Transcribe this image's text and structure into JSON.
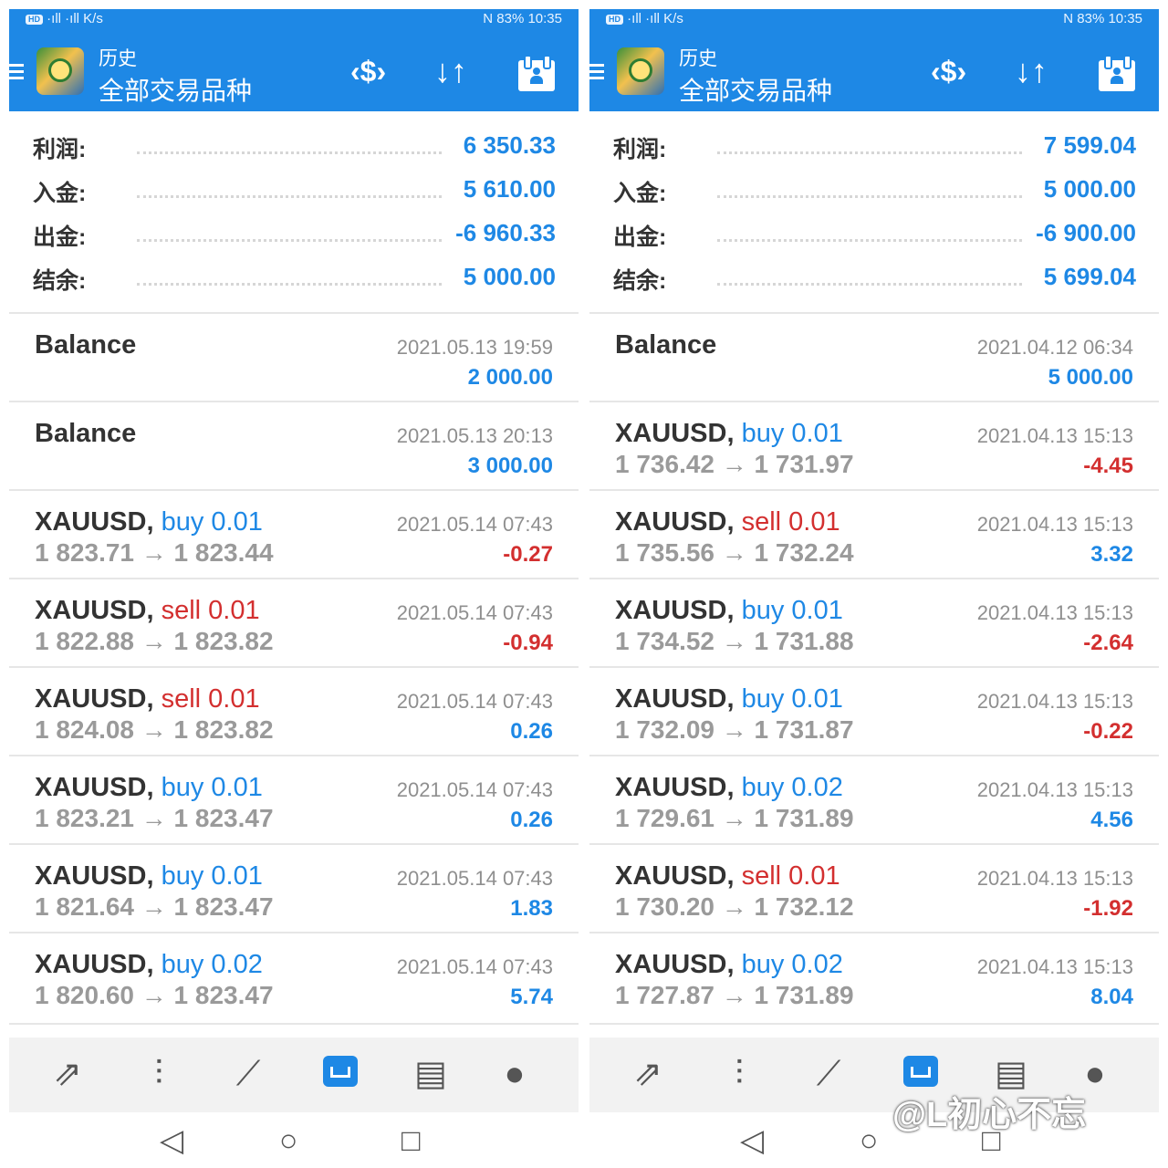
{
  "status_bar": {
    "signal": "·ıll ·ıll",
    "rate": "K/s",
    "right": "N 83% 10:35",
    "hd": "HD"
  },
  "appbar": {
    "title_small": "历史",
    "title_big": "全部交易品种",
    "money_icon": "$",
    "sort_icon": "↓↑"
  },
  "icons": {
    "nav": [
      "trade-arrows-icon",
      "candlestick-icon",
      "chart-line-icon",
      "inbox-icon",
      "news-icon",
      "chat-icon"
    ],
    "system": [
      "back-icon",
      "home-icon",
      "recents-icon"
    ]
  },
  "colors": {
    "brand": "#1e88e5",
    "negative": "#d32f2f"
  },
  "panels": [
    {
      "summary": [
        {
          "label": "利润:",
          "value": "6 350.33"
        },
        {
          "label": "入金:",
          "value": "5 610.00"
        },
        {
          "label": "出金:",
          "value": "-6 960.33"
        },
        {
          "label": "结余:",
          "value": "5 000.00"
        }
      ],
      "items": [
        {
          "symbol": "Balance",
          "sep": "",
          "action": "",
          "side": "",
          "price": "",
          "date": "2021.05.13 19:59",
          "profit": "2 000.00",
          "sign": "pos"
        },
        {
          "symbol": "Balance",
          "sep": "",
          "action": "",
          "side": "",
          "price": "",
          "date": "2021.05.13 20:13",
          "profit": "3 000.00",
          "sign": "pos"
        },
        {
          "symbol": "XAUUSD",
          "sep": ", ",
          "action": "buy 0.01",
          "side": "buy",
          "price": "1 823.71 → 1 823.44",
          "date": "2021.05.14 07:43",
          "profit": "-0.27",
          "sign": "neg"
        },
        {
          "symbol": "XAUUSD",
          "sep": ", ",
          "action": "sell 0.01",
          "side": "sell",
          "price": "1 822.88 → 1 823.82",
          "date": "2021.05.14 07:43",
          "profit": "-0.94",
          "sign": "neg"
        },
        {
          "symbol": "XAUUSD",
          "sep": ", ",
          "action": "sell 0.01",
          "side": "sell",
          "price": "1 824.08 → 1 823.82",
          "date": "2021.05.14 07:43",
          "profit": "0.26",
          "sign": "pos"
        },
        {
          "symbol": "XAUUSD",
          "sep": ", ",
          "action": "buy 0.01",
          "side": "buy",
          "price": "1 823.21 → 1 823.47",
          "date": "2021.05.14 07:43",
          "profit": "0.26",
          "sign": "pos"
        },
        {
          "symbol": "XAUUSD",
          "sep": ", ",
          "action": "buy 0.01",
          "side": "buy",
          "price": "1 821.64 → 1 823.47",
          "date": "2021.05.14 07:43",
          "profit": "1.83",
          "sign": "pos"
        },
        {
          "symbol": "XAUUSD",
          "sep": ", ",
          "action": "buy 0.02",
          "side": "buy",
          "price": "1 820.60 → 1 823.47",
          "date": "2021.05.14 07:43",
          "profit": "5.74",
          "sign": "pos"
        }
      ]
    },
    {
      "summary": [
        {
          "label": "利润:",
          "value": "7 599.04"
        },
        {
          "label": "入金:",
          "value": "5 000.00"
        },
        {
          "label": "出金:",
          "value": "-6 900.00"
        },
        {
          "label": "结余:",
          "value": "5 699.04"
        }
      ],
      "items": [
        {
          "symbol": "Balance",
          "sep": "",
          "action": "",
          "side": "",
          "price": "",
          "date": "2021.04.12 06:34",
          "profit": "5 000.00",
          "sign": "pos"
        },
        {
          "symbol": "XAUUSD",
          "sep": ", ",
          "action": "buy 0.01",
          "side": "buy",
          "price": "1 736.42 → 1 731.97",
          "date": "2021.04.13 15:13",
          "profit": "-4.45",
          "sign": "neg"
        },
        {
          "symbol": "XAUUSD",
          "sep": ", ",
          "action": "sell 0.01",
          "side": "sell",
          "price": "1 735.56 → 1 732.24",
          "date": "2021.04.13 15:13",
          "profit": "3.32",
          "sign": "pos"
        },
        {
          "symbol": "XAUUSD",
          "sep": ", ",
          "action": "buy 0.01",
          "side": "buy",
          "price": "1 734.52 → 1 731.88",
          "date": "2021.04.13 15:13",
          "profit": "-2.64",
          "sign": "neg"
        },
        {
          "symbol": "XAUUSD",
          "sep": ", ",
          "action": "buy 0.01",
          "side": "buy",
          "price": "1 732.09 → 1 731.87",
          "date": "2021.04.13 15:13",
          "profit": "-0.22",
          "sign": "neg"
        },
        {
          "symbol": "XAUUSD",
          "sep": ", ",
          "action": "buy 0.02",
          "side": "buy",
          "price": "1 729.61 → 1 731.89",
          "date": "2021.04.13 15:13",
          "profit": "4.56",
          "sign": "pos"
        },
        {
          "symbol": "XAUUSD",
          "sep": ", ",
          "action": "sell 0.01",
          "side": "sell",
          "price": "1 730.20 → 1 732.12",
          "date": "2021.04.13 15:13",
          "profit": "-1.92",
          "sign": "neg"
        },
        {
          "symbol": "XAUUSD",
          "sep": ", ",
          "action": "buy 0.02",
          "side": "buy",
          "price": "1 727.87 → 1 731.89",
          "date": "2021.04.13 15:13",
          "profit": "8.04",
          "sign": "pos"
        }
      ]
    }
  ],
  "watermark": "@L初心不忘"
}
